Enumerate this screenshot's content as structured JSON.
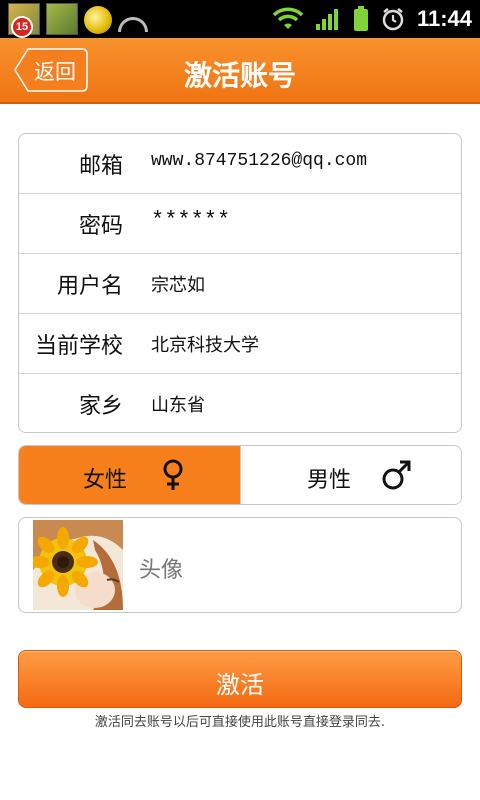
{
  "status_bar": {
    "notification_count": "15",
    "time": "11:44",
    "icons": [
      "app-notification-icon",
      "app-notification-icon",
      "sun-app-icon",
      "sync-arc-icon",
      "wifi-icon",
      "signal-icon",
      "battery-icon",
      "alarm-icon"
    ]
  },
  "header": {
    "back_label": "返回",
    "title": "激活账号"
  },
  "form": {
    "rows": [
      {
        "label": "邮箱",
        "value": "www.874751226@qq.com"
      },
      {
        "label": "密码",
        "value": "******"
      },
      {
        "label": "用户名",
        "value": "宗芯如"
      },
      {
        "label": "当前学校",
        "value": "北京科技大学"
      },
      {
        "label": "家乡",
        "value": "山东省"
      }
    ]
  },
  "gender": {
    "female_label": "女性",
    "male_label": "男性",
    "selected": "female"
  },
  "avatar": {
    "label": "头像"
  },
  "activate": {
    "label": "激活",
    "note": "激活同去账号以后可直接使用此账号直接登录同去."
  },
  "colors": {
    "accent": "#f7801d",
    "header": "#f07414"
  }
}
